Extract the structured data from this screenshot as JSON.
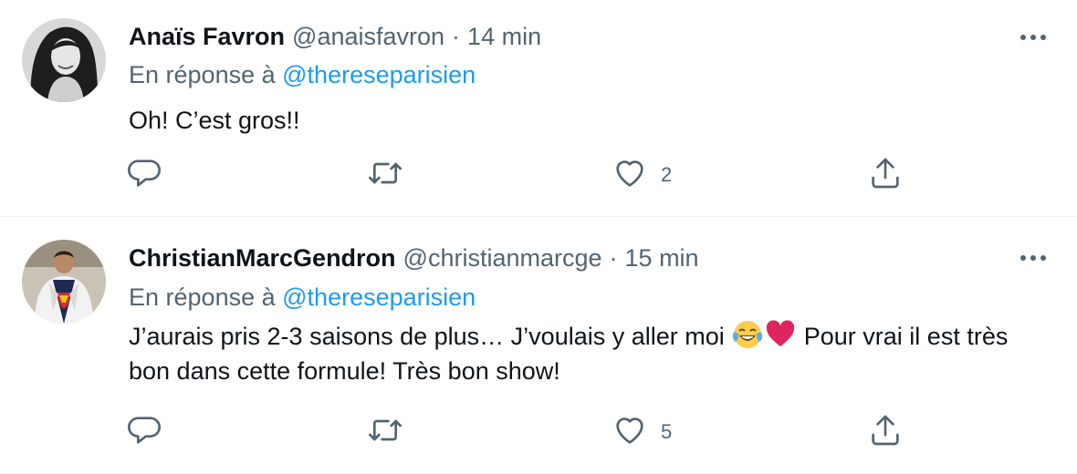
{
  "colors": {
    "link": "#1d9bf0",
    "secondary_text": "#536471",
    "primary_text": "#0f1419",
    "heart_emoji": "#e0245e"
  },
  "tweets": [
    {
      "author": "Anaïs Favron",
      "handle": "@anaisfavron",
      "separator": "·",
      "time": "14 min",
      "reply_prefix": "En réponse à",
      "reply_to": "@thereseparisien",
      "text": "Oh! C’est gros!!",
      "likes": "2",
      "icons": [
        "reply-icon",
        "retweet-icon",
        "like-icon",
        "share-icon",
        "more-icon"
      ]
    },
    {
      "author": "ChristianMarcGendron",
      "handle": "@christianmarcge",
      "separator": "·",
      "time": "15 min",
      "reply_prefix": "En réponse à",
      "reply_to": "@thereseparisien",
      "text_before_emoji": "J’aurais pris 2-3 saisons de plus… J’voulais y aller moi ",
      "emojis": [
        "tears-of-joy-emoji",
        "red-heart-emoji"
      ],
      "text_after_emoji": " Pour vrai il est très bon dans cette formule! Très bon show!",
      "likes": "5",
      "icons": [
        "reply-icon",
        "retweet-icon",
        "like-icon",
        "share-icon",
        "more-icon"
      ]
    }
  ]
}
